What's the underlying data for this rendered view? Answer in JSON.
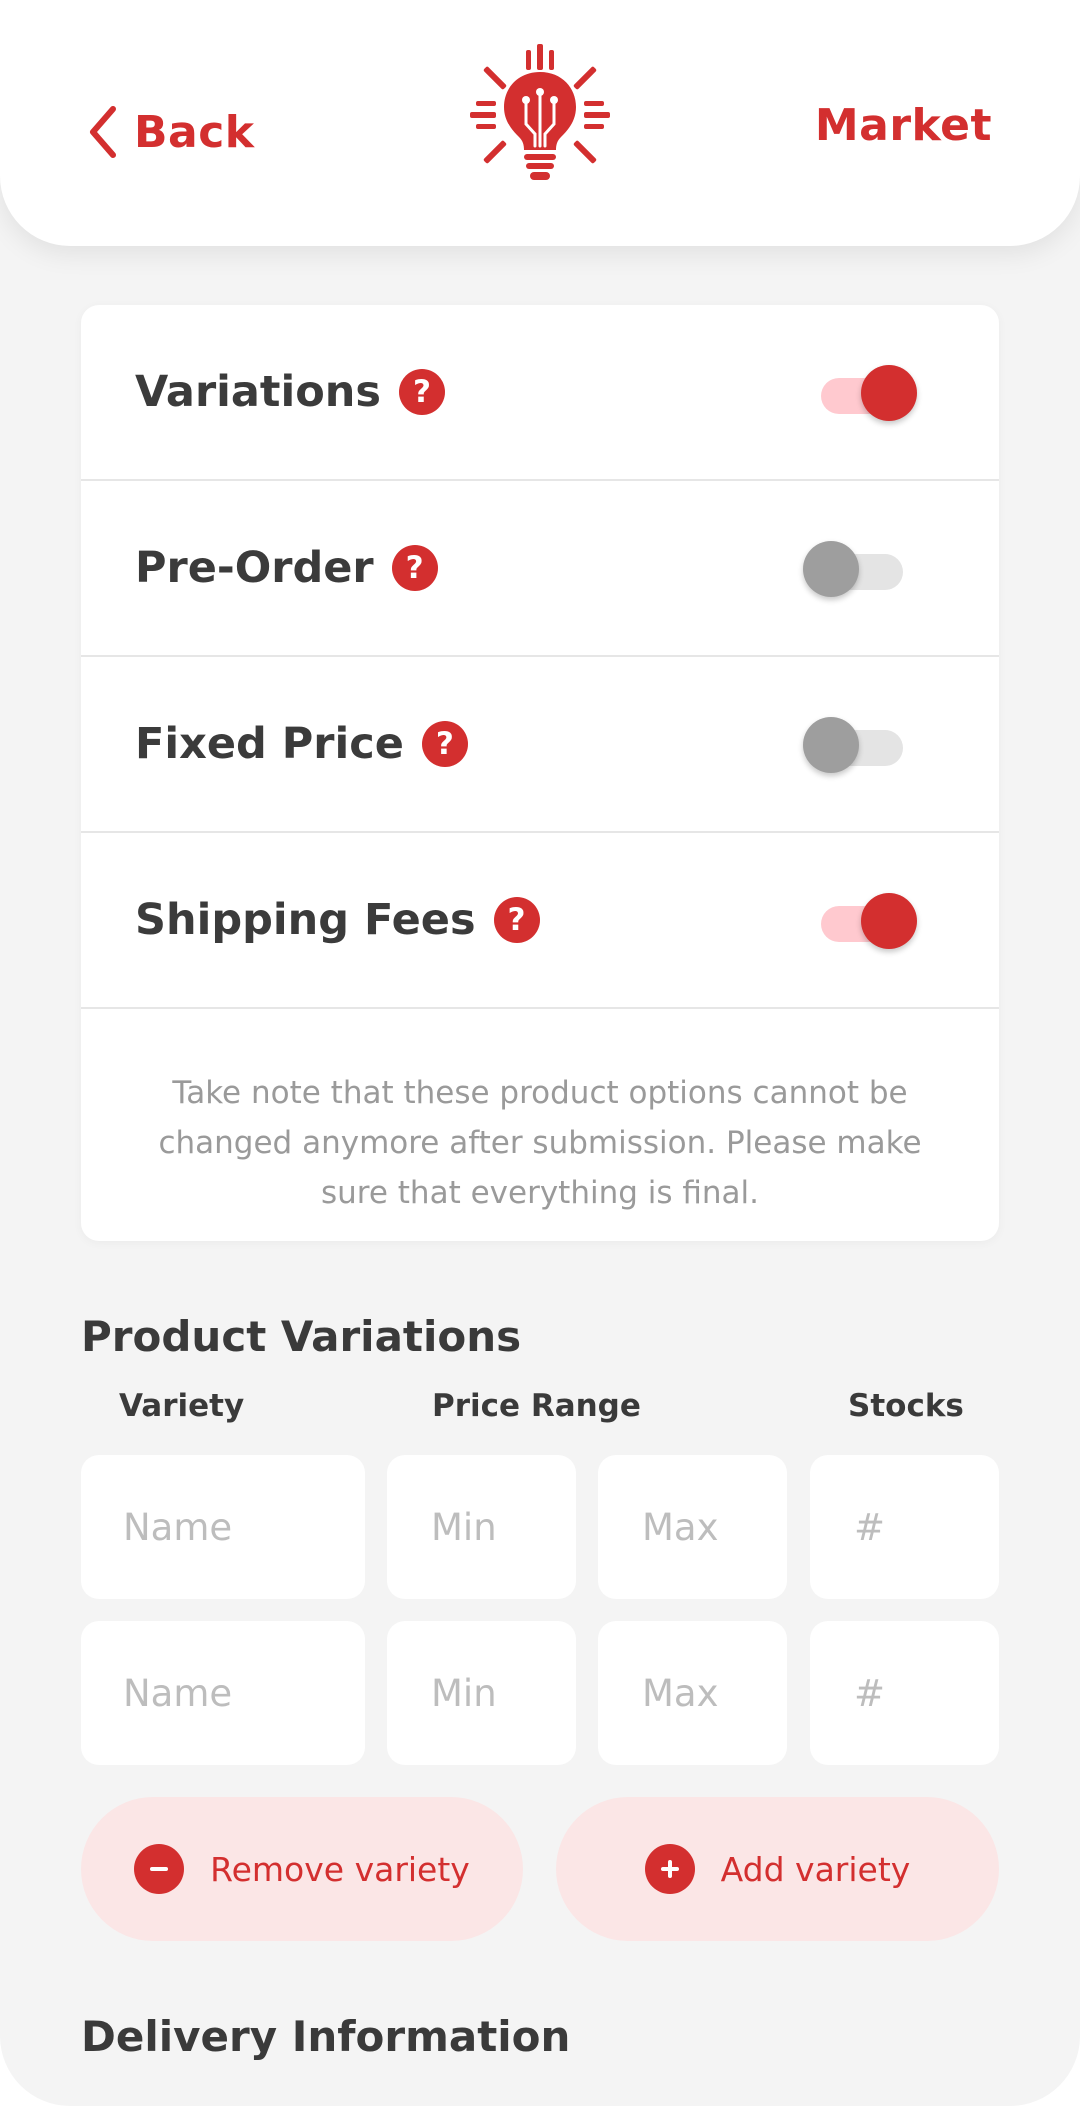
{
  "header": {
    "back_label": "Back",
    "market_label": "Market"
  },
  "options": [
    {
      "label": "Variations",
      "enabled": true
    },
    {
      "label": "Pre-Order",
      "enabled": false
    },
    {
      "label": "Fixed Price",
      "enabled": false
    },
    {
      "label": "Shipping Fees",
      "enabled": true
    }
  ],
  "help_glyph": "?",
  "note_text": "Take note that these product options cannot be changed anymore after submission. Please make sure that everything is final.",
  "product_variations": {
    "title": "Product Variations",
    "columns": {
      "variety": "Variety",
      "price_range": "Price Range",
      "stocks": "Stocks"
    },
    "placeholders": {
      "name": "Name",
      "min": "Min",
      "max": "Max",
      "stocks": "#"
    },
    "remove_label": "Remove variety",
    "add_label": "Add variety"
  },
  "delivery": {
    "title": "Delivery Information"
  },
  "colors": {
    "accent": "#d32f2f",
    "accent_light": "#ffc9cf",
    "pill_bg": "#fbe6e6",
    "page_bg": "#f4f4f4"
  },
  "icons": {
    "back": "chevron-left-icon",
    "logo": "lightbulb-sunburst-logo",
    "help": "question-circle-icon",
    "remove": "minus-circle-icon",
    "add": "plus-circle-icon"
  }
}
